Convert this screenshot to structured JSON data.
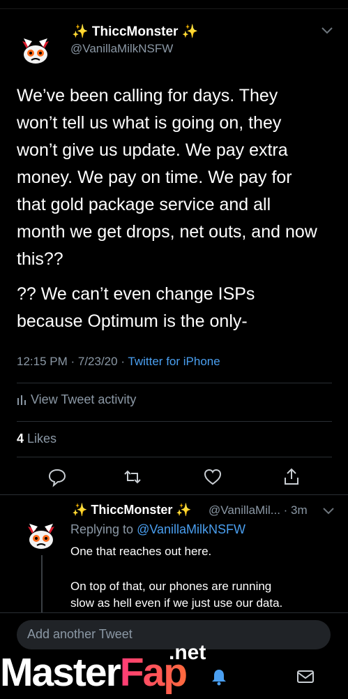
{
  "main_tweet": {
    "display_name": "✨ ThiccMonster ✨",
    "handle": "@VanillaMilkNSFW",
    "text_lines": [
      "We’ve been calling for days. They",
      "won’t tell us what is going on, they",
      "won’t give us update. We pay extra",
      "money. We pay on time. We pay for",
      "that gold package service and all",
      "month we get drops, net outs, and now",
      "this??"
    ],
    "text_lines_2": [
      "?? We can’t even change ISPs",
      "because Optimum is the only-"
    ],
    "time": "12:15 PM · 7/23/20 · ",
    "source": "Twitter for iPhone",
    "activity_label": "View Tweet activity",
    "likes_count": "4",
    "likes_label": " Likes"
  },
  "reply_tweet": {
    "display_name": "✨ ThiccMonster ✨",
    "handle_time": "@VanillaMil... · 3m",
    "replying_prefix": "Replying to ",
    "replying_to": "@VanillaMilkNSFW",
    "para1": "One that reaches out here.",
    "para2_lines": [
      "On top of that, our phones are running",
      "slow as hell even if we just use our data."
    ]
  },
  "compose": {
    "placeholder": "Add another Tweet"
  },
  "watermark": {
    "part1": "Master",
    "part2": "Fap",
    "suffix": ".net"
  },
  "colors": {
    "background": "#000000",
    "accent": "#4a9ff0",
    "secondary_text": "#8b98a5"
  }
}
